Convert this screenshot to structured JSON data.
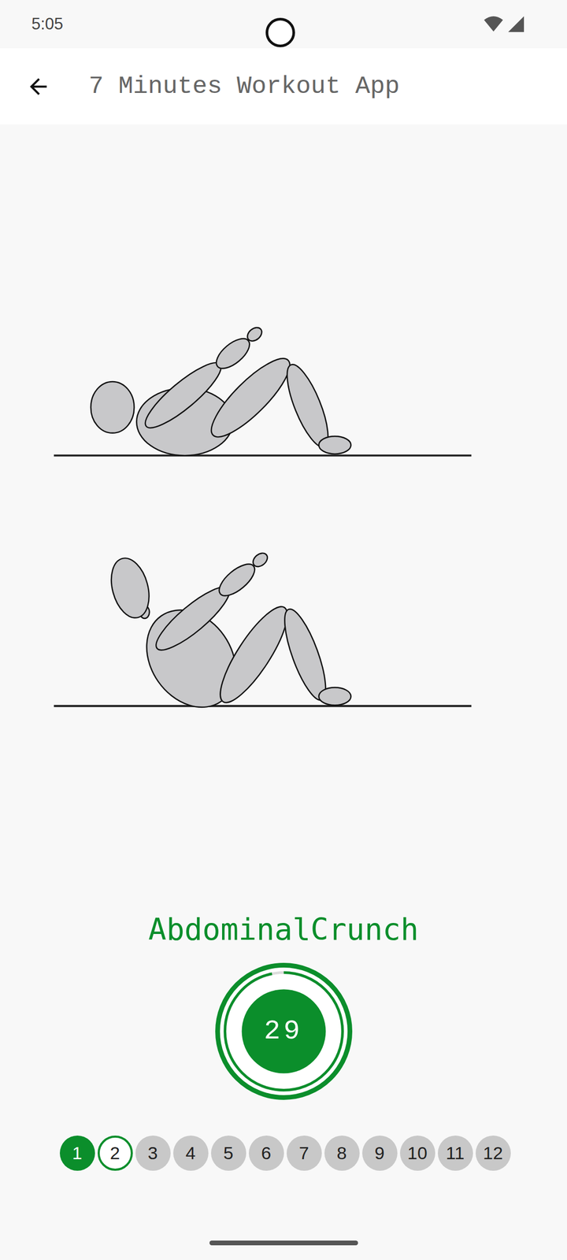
{
  "status_bar": {
    "time": "5:05"
  },
  "app_bar": {
    "title": "7 Minutes Workout App"
  },
  "exercise": {
    "name": "AbdominalCrunch"
  },
  "timer": {
    "reading": "29",
    "level": 0.967
  },
  "steps": [
    {
      "label": "1",
      "completed": true,
      "selected": false
    },
    {
      "label": "2",
      "completed": false,
      "selected": true
    },
    {
      "label": "3",
      "completed": false,
      "selected": false
    },
    {
      "label": "4",
      "completed": false,
      "selected": false
    },
    {
      "label": "5",
      "completed": false,
      "selected": false
    },
    {
      "label": "6",
      "completed": false,
      "selected": false
    },
    {
      "label": "7",
      "completed": false,
      "selected": false
    },
    {
      "label": "8",
      "completed": false,
      "selected": false
    },
    {
      "label": "9",
      "completed": false,
      "selected": false
    },
    {
      "label": "10",
      "completed": false,
      "selected": false
    },
    {
      "label": "11",
      "completed": false,
      "selected": false
    },
    {
      "label": "12",
      "completed": false,
      "selected": false
    }
  ]
}
